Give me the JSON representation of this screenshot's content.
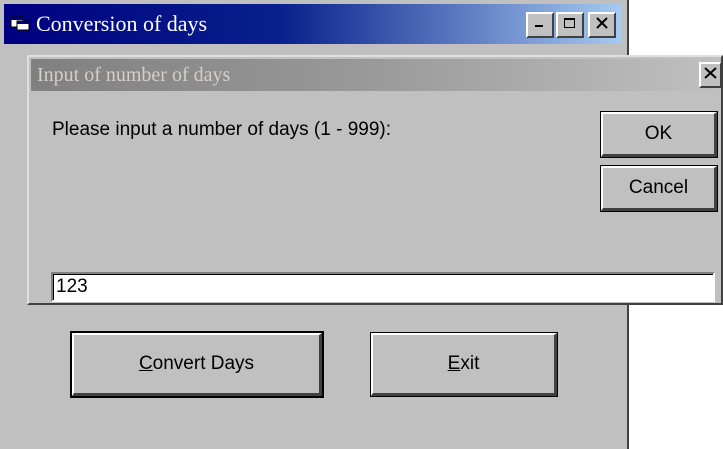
{
  "main_window": {
    "title": "Conversion of days",
    "app_icon": "window-app-icon",
    "caption_buttons": {
      "minimize_icon": "minimize-icon",
      "maximize_icon": "maximize-icon",
      "close_icon": "close-icon"
    },
    "buttons": {
      "convert_mnemonic": "C",
      "convert_rest": "onvert Days",
      "exit_mnemonic": "E",
      "exit_rest": "xit"
    }
  },
  "dialog": {
    "title": "Input of number of days",
    "close_icon": "close-icon",
    "prompt": "Please input a number of days (1 - 999):",
    "ok_label": "OK",
    "cancel_label": "Cancel",
    "input_value": "123"
  },
  "colors": {
    "active_titlebar": "#000080",
    "inactive_titlebar": "#808080",
    "face": "#c0c0c0"
  }
}
